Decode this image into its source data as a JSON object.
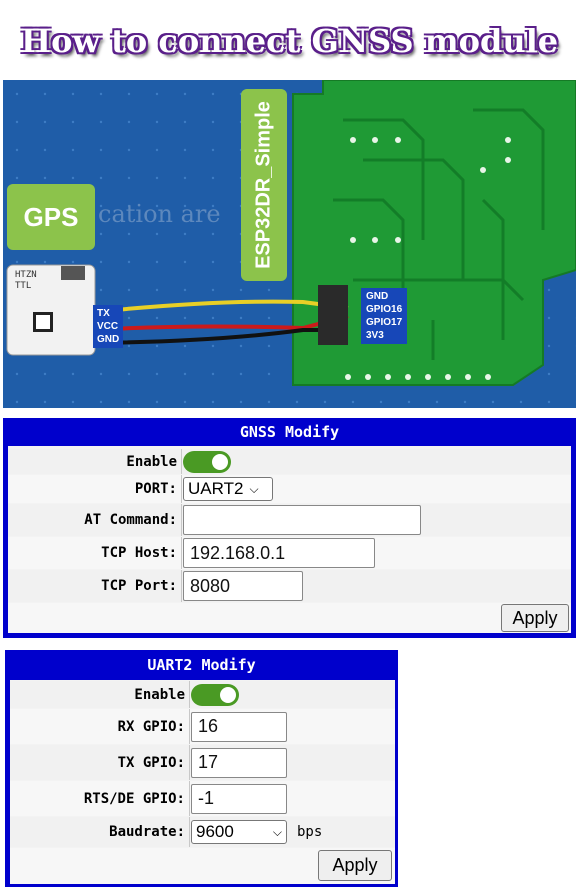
{
  "title": "How to connect GNSS module",
  "photo": {
    "gps_label": "GPS",
    "board_label": "ESP32DR_Simple",
    "watermark": "cation are",
    "gps_pins": [
      "TX",
      "VCC",
      "GND"
    ],
    "board_pins": [
      "GND",
      "GPIO16",
      "GPIO17",
      "3V3"
    ],
    "module_text": [
      "HTZN",
      "TTL"
    ]
  },
  "gnss": {
    "header": "GNSS Modify",
    "enable_label": "Enable",
    "enable_on": true,
    "port_label": "PORT:",
    "port_value": "UART2",
    "at_label": "AT Command:",
    "at_value": "",
    "host_label": "TCP Host:",
    "host_value": "192.168.0.1",
    "port_num_label": "TCP Port:",
    "port_num_value": "8080",
    "apply": "Apply"
  },
  "uart": {
    "header": "UART2 Modify",
    "enable_label": "Enable",
    "enable_on": true,
    "rx_label": "RX GPIO:",
    "rx_value": "16",
    "tx_label": "TX GPIO:",
    "tx_value": "17",
    "rts_label": "RTS/DE GPIO:",
    "rts_value": "-1",
    "baud_label": "Baudrate:",
    "baud_value": "9600",
    "baud_unit": "bps",
    "apply": "Apply"
  },
  "colors": {
    "panel_border": "#0000cc",
    "toggle_on": "#4a9a24",
    "title_outline": "#5a1f8a"
  }
}
